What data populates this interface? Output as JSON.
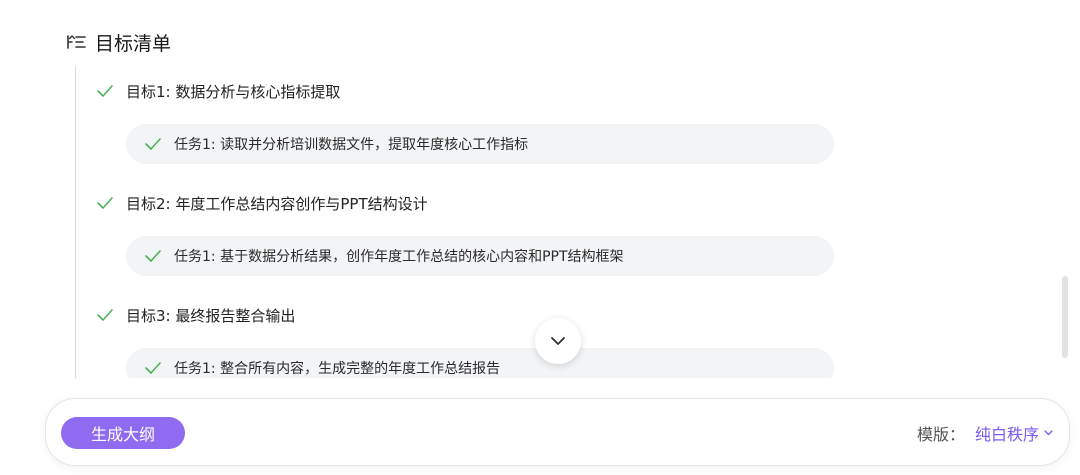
{
  "header": {
    "title": "目标清单",
    "icon": "checklist-icon"
  },
  "goals": [
    {
      "label": "目标1: 数据分析与核心指标提取",
      "task": "任务1: 读取并分析培训数据文件，提取年度核心工作指标"
    },
    {
      "label": "目标2: 年度工作总结内容创作与PPT结构设计",
      "task": "任务1: 基于数据分析结果，创作年度工作总结的核心内容和PPT结构框架"
    },
    {
      "label": "目标3: 最终报告整合输出",
      "task": "任务1: 整合所有内容，生成完整的年度工作总结报告"
    }
  ],
  "footer": {
    "generate_label": "生成大纲",
    "template_label": "模版：",
    "template_value": "纯白秩序"
  },
  "colors": {
    "check": "#4bb35a",
    "accent": "#8f6bf1",
    "link": "#7a5af0"
  }
}
